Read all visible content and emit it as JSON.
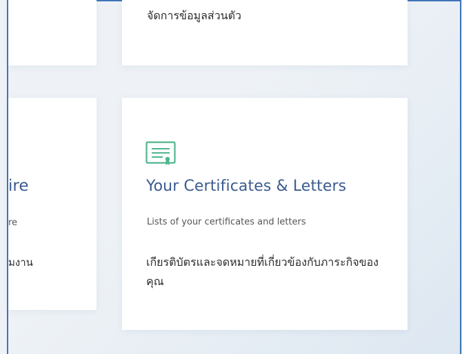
{
  "top_card": {
    "thai_text": "จัดการข้อมูลส่วนตัว"
  },
  "left_card": {
    "title_fragment": "ire",
    "subtitle_fragment": "re",
    "thai_fragment": "มงาน"
  },
  "certificates_card": {
    "icon": "certificate-icon",
    "title": "Your Certificates & Letters",
    "description": "Lists of your certificates and letters",
    "thai_description": "เกียรติบัตรและจดหมายที่เกี่ยวข้องกับภาระกิจของคุณ"
  },
  "colors": {
    "accent_green": "#4fb58d",
    "title_blue": "#3b5b8f",
    "frame_blue": "#3f74b8"
  }
}
